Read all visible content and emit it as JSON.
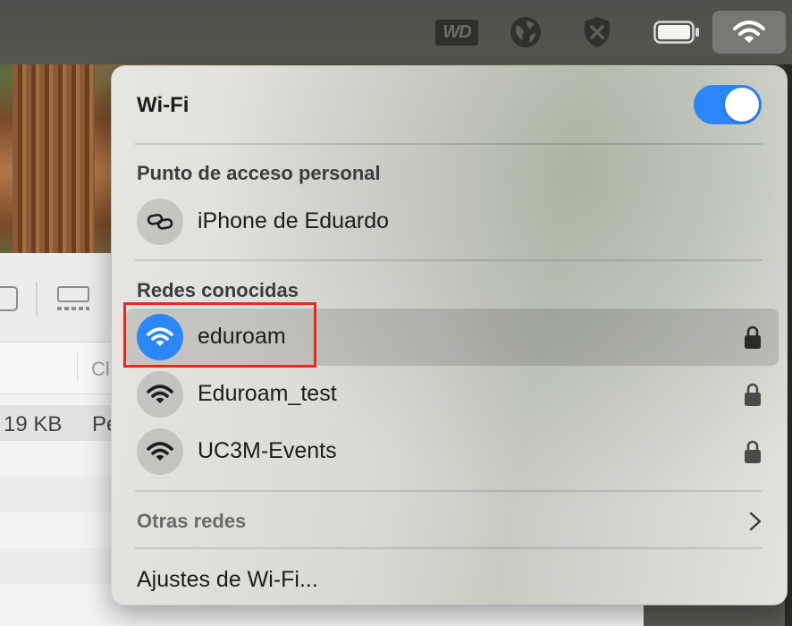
{
  "menubar": {
    "wd_label": "WD",
    "icons": [
      "wd-drive-icon",
      "globe-icon",
      "shield-x-icon",
      "battery-icon",
      "wifi-status-icon"
    ]
  },
  "finder": {
    "column_label": "Cl",
    "row_size": "19 KB",
    "row_kind": "Pe"
  },
  "wifi_panel": {
    "title": "Wi-Fi",
    "enabled": true,
    "hotspot_section": "Punto de acceso personal",
    "hotspot_device": "iPhone de Eduardo",
    "known_section": "Redes conocidas",
    "known_networks": [
      {
        "name": "eduroam",
        "connected": true,
        "locked": true
      },
      {
        "name": "Eduroam_test",
        "connected": false,
        "locked": true
      },
      {
        "name": "UC3M-Events",
        "connected": false,
        "locked": true
      }
    ],
    "other_networks": "Otras redes",
    "settings": "Ajustes de Wi-Fi..."
  },
  "colors": {
    "accent": "#2d86f5",
    "highlight": "#e8291c"
  }
}
